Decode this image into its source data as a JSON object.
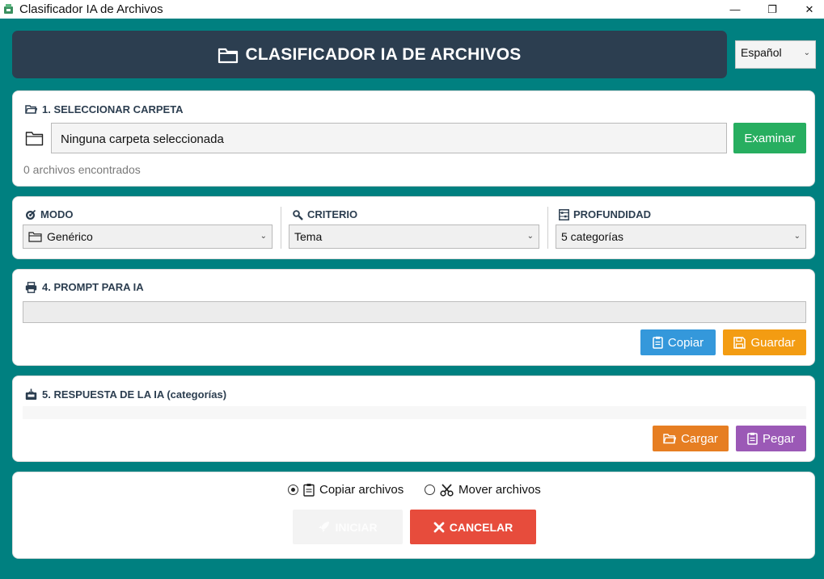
{
  "window": {
    "title": "Clasificador IA de Archivos",
    "minimize": "—",
    "maximize": "❐",
    "close": "✕"
  },
  "header": {
    "title": "CLASIFICADOR IA DE ARCHIVOS",
    "icon": "folder-icon"
  },
  "language": {
    "selected": "Español"
  },
  "section1": {
    "title": "1. SELECCIONAR CARPETA",
    "path_value": "Ninguna carpeta seleccionada",
    "browse_label": "Examinar",
    "files_count": "0 archivos encontrados"
  },
  "options": {
    "mode": {
      "label": "MODO",
      "value": "Genérico",
      "icon": "dart-icon"
    },
    "criteria": {
      "label": "CRITERIO",
      "value": "Tema",
      "icon": "magnifier-icon"
    },
    "depth": {
      "label": "PROFUNDIDAD",
      "value": "5 categorías",
      "icon": "abacus-icon"
    }
  },
  "section4": {
    "title": "4. PROMPT PARA IA",
    "prompt_value": "",
    "copy_label": "Copiar",
    "save_label": "Guardar"
  },
  "section5": {
    "title": "5. RESPUESTA DE LA IA (categorías)",
    "response_value": "",
    "load_label": "Cargar",
    "paste_label": "Pegar"
  },
  "actions": {
    "copy_files_label": "Copiar archivos",
    "move_files_label": "Mover archivos",
    "selected_operation": "copy",
    "start_label": "INICIAR",
    "cancel_label": "CANCELAR"
  },
  "colors": {
    "background": "#008080",
    "header": "#2c3e50",
    "green": "#27ae60",
    "blue": "#3498db",
    "orange": "#f39c12",
    "dark_orange": "#e67e22",
    "purple": "#9b59b6",
    "red": "#e74c3c"
  }
}
